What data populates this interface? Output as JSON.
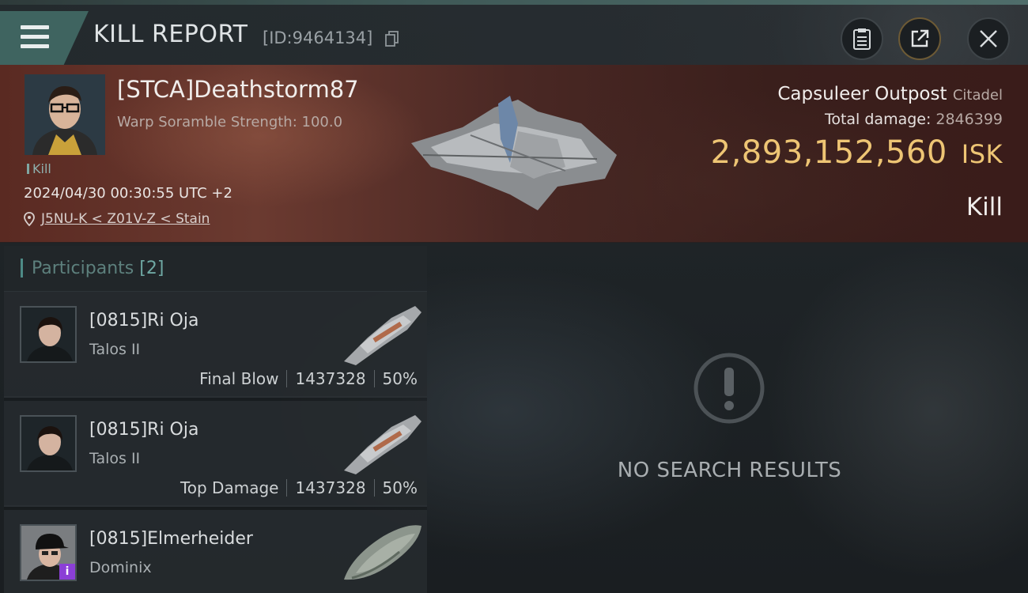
{
  "header": {
    "title": "KILL REPORT",
    "report_id": "[ID:9464134]",
    "menu_icon": "hamburger-icon",
    "buttons": [
      {
        "icon": "clipboard-icon"
      },
      {
        "icon": "share-icon"
      },
      {
        "icon": "close-icon"
      }
    ]
  },
  "victim": {
    "name": "[STCA]Deathstorm87",
    "warp_scramble": "Warp Soramble Strength: 100.0",
    "tag": "Kill",
    "datetime": "2024/04/30 00:30:55 UTC +2",
    "location": "J5NU-K < Z01V-Z < Stain"
  },
  "target": {
    "name": "Capsuleer Outpost",
    "type": "Citadel",
    "total_damage_label": "Total damage:",
    "total_damage_value": "2846399",
    "isk_value": "2,893,152,560",
    "isk_unit": "ISK",
    "result": "Kill"
  },
  "participants": {
    "label": "Participants",
    "count": "[2]",
    "rows": [
      {
        "name": "[0815]Ri Oja",
        "ship": "Talos II",
        "role": "Final Blow",
        "damage": "1437328",
        "percent": "50%"
      },
      {
        "name": "[0815]Ri Oja",
        "ship": "Talos II",
        "role": "Top Damage",
        "damage": "1437328",
        "percent": "50%"
      },
      {
        "name": "[0815]Elmerheider",
        "ship": "Dominix",
        "badge": "i"
      }
    ]
  },
  "empty_state": {
    "icon": "alert-icon",
    "text": "NO SEARCH RESULTS"
  },
  "colors": {
    "accent_teal": "#3f6460",
    "isk_gold": "#eec574",
    "banner_red": "#5a2a22"
  }
}
